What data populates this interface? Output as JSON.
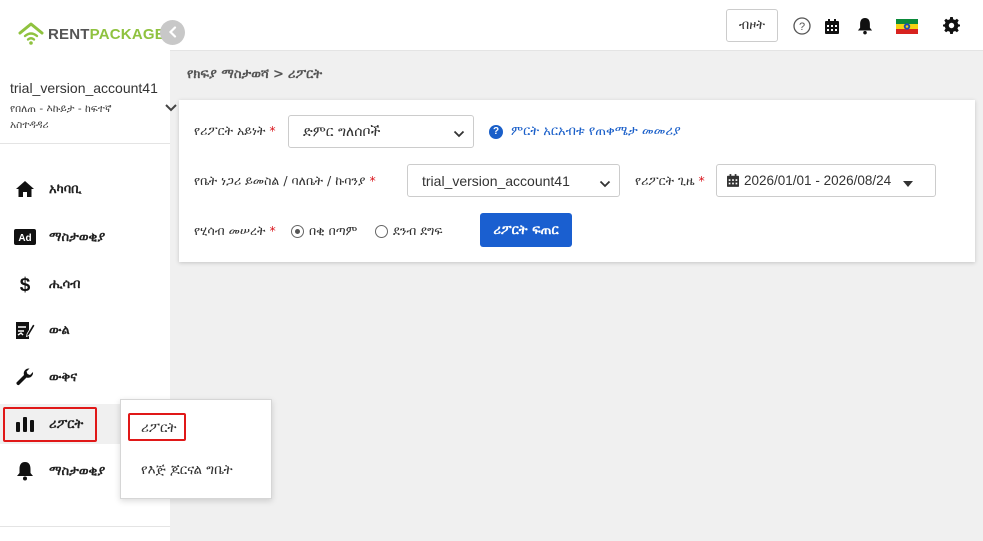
{
  "brand": {
    "name_part1": "RENT",
    "name_part2": "PACKAGE",
    "accent": "#8fc23f"
  },
  "account": {
    "name": "trial_version_account41",
    "role": "የበለጠ - እኩይታ - ከፍተኛ አስተዳዳሪ"
  },
  "sidebar": {
    "items": [
      {
        "label": "አካባቢ",
        "icon": "home-icon"
      },
      {
        "label": "ማስታወቂያ",
        "icon": "ad-icon"
      },
      {
        "label": "ሒሳብ",
        "icon": "dollar-icon"
      },
      {
        "label": "ውል",
        "icon": "contract-icon"
      },
      {
        "label": "ውቅና",
        "icon": "wrench-icon"
      },
      {
        "label": "ሪፖርት",
        "icon": "bar-chart-icon"
      },
      {
        "label": "ማስታወቂያ",
        "icon": "bell-icon"
      }
    ]
  },
  "popup": {
    "items": [
      "ሪፖርት",
      "የእጅ ጆርናል ግቤት"
    ]
  },
  "topbar": {
    "button_label": "ብዞት",
    "icons": [
      "help-icon",
      "calendar-icon",
      "bell-icon",
      "flag-icon",
      "gear-icon"
    ]
  },
  "breadcrumb": {
    "parent": "የክፍያ ማስታወሻ",
    "separator": ">",
    "current": "ሪፖርት"
  },
  "form": {
    "report_type_label": "የሪፖርት አይነት",
    "report_type_value": "ድምር ግለሰቦች",
    "help_link": "ምርት አርአብቱ የጠቀሜታ መመሪያ",
    "property_label": "የቤት ነጋሪ ይመስል / ባለቤት / ኩባንያ",
    "property_value": "trial_version_account41",
    "period_label": "የሪፖርት ጊዜ",
    "period_value": "2026/01/01 - 2026/08/24",
    "basis_label": "የሂሳብ መሠረት",
    "basis_options": [
      "በቂ በጣም",
      "ደንብ ደግፍ"
    ],
    "basis_selected": 0,
    "submit_label": "ሪፖርት ፍጠር",
    "required_mark": "*"
  },
  "colors": {
    "primary": "#1a5fd0",
    "highlight": "#e01818",
    "required": "#d9141c"
  }
}
